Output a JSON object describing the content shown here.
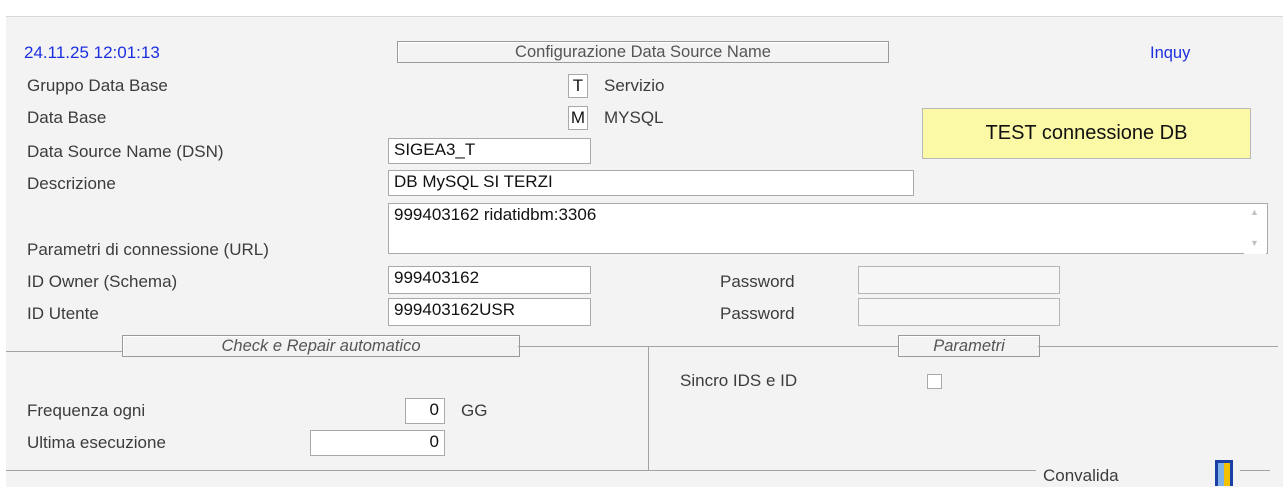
{
  "header": {
    "timestamp": "24.11.25 12:01:13",
    "title": "Configurazione Data Source Name",
    "user": "Inquy"
  },
  "form": {
    "gruppo_db": {
      "label": "Gruppo Data Base",
      "code": "T",
      "desc": "Servizio"
    },
    "data_base": {
      "label": "Data Base",
      "code": "M",
      "desc": "MYSQL"
    },
    "dsn": {
      "label": "Data Source Name (DSN)",
      "value": "SIGEA3_T"
    },
    "descrizione": {
      "label": "Descrizione",
      "value": "DB MySQL SI TERZI"
    },
    "url": {
      "label": "Parametri di connessione (URL)",
      "value": "999403162 ridatidbm:3306"
    },
    "owner": {
      "label": "ID Owner (Schema)",
      "value": "999403162",
      "password_label": "Password",
      "password_value": ""
    },
    "utente": {
      "label": "ID Utente",
      "value": "999403162USR",
      "password_label": "Password",
      "password_value": ""
    }
  },
  "test_button": {
    "label": "TEST connessione DB"
  },
  "check_repair": {
    "title": "Check e Repair automatico",
    "frequenza_label": "Frequenza ogni",
    "frequenza_value": "0",
    "frequenza_unit": "GG",
    "ultima_label": "Ultima esecuzione",
    "ultima_value": "0"
  },
  "parametri": {
    "title": "Parametri",
    "sincro_label": "Sincro IDS e ID",
    "sincro_checked": false
  },
  "footer": {
    "convalida_label": "Convalida",
    "convalida_icon": "door-icon"
  },
  "colors": {
    "accent_blue": "#1c2fe0",
    "test_button_bg": "#fbf8a6",
    "panel_bg": "#f3f3f3"
  }
}
